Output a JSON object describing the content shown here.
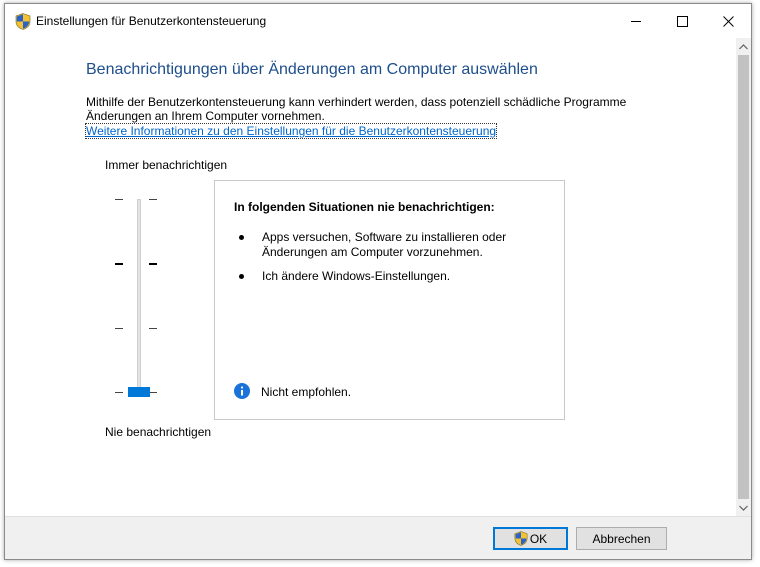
{
  "window": {
    "title": "Einstellungen für Benutzerkontensteuerung",
    "icon": "uac-shield-icon"
  },
  "main": {
    "heading": "Benachrichtigungen über Änderungen am Computer auswählen",
    "description": "Mithilfe der Benutzerkontensteuerung kann verhindert werden, dass potenziell schädliche Programme Änderungen an Ihrem Computer vornehmen.",
    "link": "Weitere Informationen zu den Einstellungen für die Benutzerkontensteuerung"
  },
  "slider": {
    "label_top": "Immer benachrichtigen",
    "label_bottom": "Nie benachrichtigen",
    "levels": 4,
    "selected_level": 1,
    "accent_color": "#0078d7"
  },
  "infobox": {
    "title": "In folgenden Situationen nie benachrichtigen:",
    "bullets": [
      "Apps versuchen, Software zu installieren oder Änderungen am Computer vorzunehmen.",
      "Ich ändere Windows-Einstellungen."
    ],
    "note": "Nicht empfohlen.",
    "note_icon": "info-icon"
  },
  "buttons": {
    "ok": "OK",
    "cancel": "Abbrechen"
  },
  "colors": {
    "heading": "#1e4e8c",
    "link": "#0066cc"
  }
}
